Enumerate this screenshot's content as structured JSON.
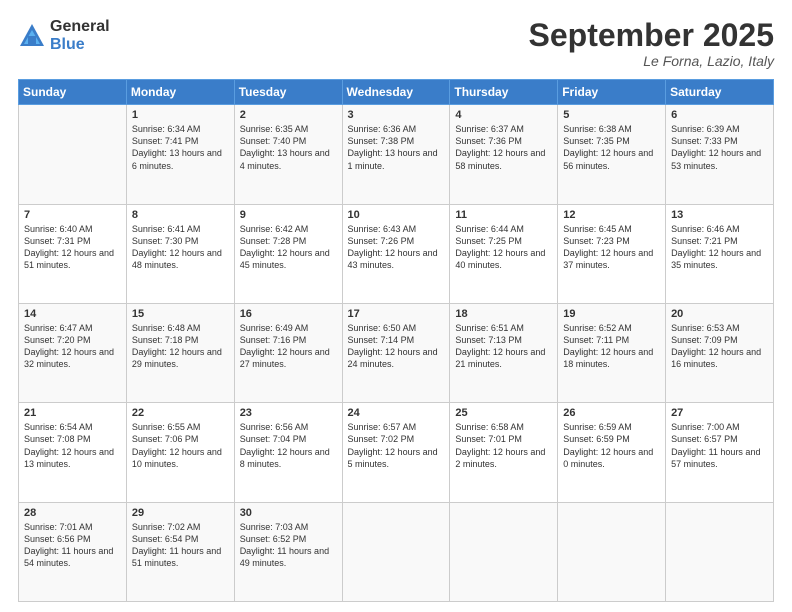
{
  "logo": {
    "general": "General",
    "blue": "Blue"
  },
  "header": {
    "month": "September 2025",
    "location": "Le Forna, Lazio, Italy"
  },
  "days_of_week": [
    "Sunday",
    "Monday",
    "Tuesday",
    "Wednesday",
    "Thursday",
    "Friday",
    "Saturday"
  ],
  "weeks": [
    [
      {
        "day": "",
        "sunrise": "",
        "sunset": "",
        "daylight": ""
      },
      {
        "day": "1",
        "sunrise": "Sunrise: 6:34 AM",
        "sunset": "Sunset: 7:41 PM",
        "daylight": "Daylight: 13 hours and 6 minutes."
      },
      {
        "day": "2",
        "sunrise": "Sunrise: 6:35 AM",
        "sunset": "Sunset: 7:40 PM",
        "daylight": "Daylight: 13 hours and 4 minutes."
      },
      {
        "day": "3",
        "sunrise": "Sunrise: 6:36 AM",
        "sunset": "Sunset: 7:38 PM",
        "daylight": "Daylight: 13 hours and 1 minute."
      },
      {
        "day": "4",
        "sunrise": "Sunrise: 6:37 AM",
        "sunset": "Sunset: 7:36 PM",
        "daylight": "Daylight: 12 hours and 58 minutes."
      },
      {
        "day": "5",
        "sunrise": "Sunrise: 6:38 AM",
        "sunset": "Sunset: 7:35 PM",
        "daylight": "Daylight: 12 hours and 56 minutes."
      },
      {
        "day": "6",
        "sunrise": "Sunrise: 6:39 AM",
        "sunset": "Sunset: 7:33 PM",
        "daylight": "Daylight: 12 hours and 53 minutes."
      }
    ],
    [
      {
        "day": "7",
        "sunrise": "Sunrise: 6:40 AM",
        "sunset": "Sunset: 7:31 PM",
        "daylight": "Daylight: 12 hours and 51 minutes."
      },
      {
        "day": "8",
        "sunrise": "Sunrise: 6:41 AM",
        "sunset": "Sunset: 7:30 PM",
        "daylight": "Daylight: 12 hours and 48 minutes."
      },
      {
        "day": "9",
        "sunrise": "Sunrise: 6:42 AM",
        "sunset": "Sunset: 7:28 PM",
        "daylight": "Daylight: 12 hours and 45 minutes."
      },
      {
        "day": "10",
        "sunrise": "Sunrise: 6:43 AM",
        "sunset": "Sunset: 7:26 PM",
        "daylight": "Daylight: 12 hours and 43 minutes."
      },
      {
        "day": "11",
        "sunrise": "Sunrise: 6:44 AM",
        "sunset": "Sunset: 7:25 PM",
        "daylight": "Daylight: 12 hours and 40 minutes."
      },
      {
        "day": "12",
        "sunrise": "Sunrise: 6:45 AM",
        "sunset": "Sunset: 7:23 PM",
        "daylight": "Daylight: 12 hours and 37 minutes."
      },
      {
        "day": "13",
        "sunrise": "Sunrise: 6:46 AM",
        "sunset": "Sunset: 7:21 PM",
        "daylight": "Daylight: 12 hours and 35 minutes."
      }
    ],
    [
      {
        "day": "14",
        "sunrise": "Sunrise: 6:47 AM",
        "sunset": "Sunset: 7:20 PM",
        "daylight": "Daylight: 12 hours and 32 minutes."
      },
      {
        "day": "15",
        "sunrise": "Sunrise: 6:48 AM",
        "sunset": "Sunset: 7:18 PM",
        "daylight": "Daylight: 12 hours and 29 minutes."
      },
      {
        "day": "16",
        "sunrise": "Sunrise: 6:49 AM",
        "sunset": "Sunset: 7:16 PM",
        "daylight": "Daylight: 12 hours and 27 minutes."
      },
      {
        "day": "17",
        "sunrise": "Sunrise: 6:50 AM",
        "sunset": "Sunset: 7:14 PM",
        "daylight": "Daylight: 12 hours and 24 minutes."
      },
      {
        "day": "18",
        "sunrise": "Sunrise: 6:51 AM",
        "sunset": "Sunset: 7:13 PM",
        "daylight": "Daylight: 12 hours and 21 minutes."
      },
      {
        "day": "19",
        "sunrise": "Sunrise: 6:52 AM",
        "sunset": "Sunset: 7:11 PM",
        "daylight": "Daylight: 12 hours and 18 minutes."
      },
      {
        "day": "20",
        "sunrise": "Sunrise: 6:53 AM",
        "sunset": "Sunset: 7:09 PM",
        "daylight": "Daylight: 12 hours and 16 minutes."
      }
    ],
    [
      {
        "day": "21",
        "sunrise": "Sunrise: 6:54 AM",
        "sunset": "Sunset: 7:08 PM",
        "daylight": "Daylight: 12 hours and 13 minutes."
      },
      {
        "day": "22",
        "sunrise": "Sunrise: 6:55 AM",
        "sunset": "Sunset: 7:06 PM",
        "daylight": "Daylight: 12 hours and 10 minutes."
      },
      {
        "day": "23",
        "sunrise": "Sunrise: 6:56 AM",
        "sunset": "Sunset: 7:04 PM",
        "daylight": "Daylight: 12 hours and 8 minutes."
      },
      {
        "day": "24",
        "sunrise": "Sunrise: 6:57 AM",
        "sunset": "Sunset: 7:02 PM",
        "daylight": "Daylight: 12 hours and 5 minutes."
      },
      {
        "day": "25",
        "sunrise": "Sunrise: 6:58 AM",
        "sunset": "Sunset: 7:01 PM",
        "daylight": "Daylight: 12 hours and 2 minutes."
      },
      {
        "day": "26",
        "sunrise": "Sunrise: 6:59 AM",
        "sunset": "Sunset: 6:59 PM",
        "daylight": "Daylight: 12 hours and 0 minutes."
      },
      {
        "day": "27",
        "sunrise": "Sunrise: 7:00 AM",
        "sunset": "Sunset: 6:57 PM",
        "daylight": "Daylight: 11 hours and 57 minutes."
      }
    ],
    [
      {
        "day": "28",
        "sunrise": "Sunrise: 7:01 AM",
        "sunset": "Sunset: 6:56 PM",
        "daylight": "Daylight: 11 hours and 54 minutes."
      },
      {
        "day": "29",
        "sunrise": "Sunrise: 7:02 AM",
        "sunset": "Sunset: 6:54 PM",
        "daylight": "Daylight: 11 hours and 51 minutes."
      },
      {
        "day": "30",
        "sunrise": "Sunrise: 7:03 AM",
        "sunset": "Sunset: 6:52 PM",
        "daylight": "Daylight: 11 hours and 49 minutes."
      },
      {
        "day": "",
        "sunrise": "",
        "sunset": "",
        "daylight": ""
      },
      {
        "day": "",
        "sunrise": "",
        "sunset": "",
        "daylight": ""
      },
      {
        "day": "",
        "sunrise": "",
        "sunset": "",
        "daylight": ""
      },
      {
        "day": "",
        "sunrise": "",
        "sunset": "",
        "daylight": ""
      }
    ]
  ]
}
